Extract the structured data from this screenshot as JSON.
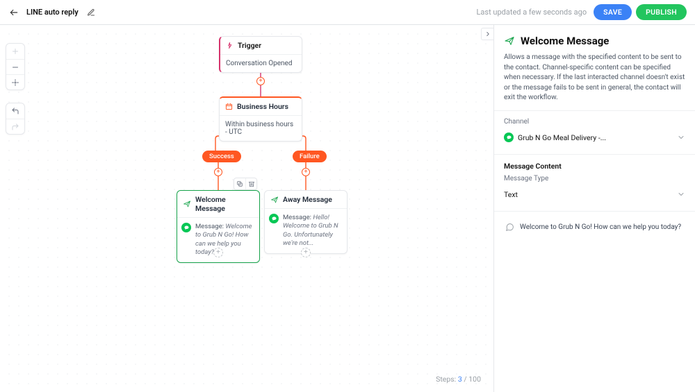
{
  "header": {
    "title": "LINE auto reply",
    "updated": "Last updated a few seconds ago",
    "save": "SAVE",
    "publish": "PUBLISH"
  },
  "canvas": {
    "steps_prefix": "Steps: ",
    "steps_current": "3",
    "steps_sep": " / ",
    "steps_max": "100",
    "trigger": {
      "title": "Trigger",
      "body": "Conversation Opened"
    },
    "business_hours": {
      "title": "Business Hours",
      "body": "Within business hours - UTC"
    },
    "pills": {
      "success": "Success",
      "failure": "Failure"
    },
    "welcome": {
      "title": "Welcome Message",
      "body_label": "Message:",
      "body_text": "Welcome to Grub N Go! How can we help  you today?"
    },
    "away": {
      "title": "Away Message",
      "body_label": "Message:",
      "body_text": "Hello! Welcome to Grub N Go. Unfortunately we're not..."
    }
  },
  "panel": {
    "title": "Welcome Message",
    "description": "Allows a message with the specified content to be sent to the contact. Channel-specific content can be specified when necessary. If the last interacted channel doesn't exist or the message fails to be sent in general, the contact will exit the workflow.",
    "channel_label": "Channel",
    "channel_value": "Grub N Go Meal Delivery -...",
    "content_section": "Message Content",
    "message_type_label": "Message Type",
    "message_type_value": "Text",
    "preview_text": "Welcome to Grub N Go! How can we help you today?"
  }
}
